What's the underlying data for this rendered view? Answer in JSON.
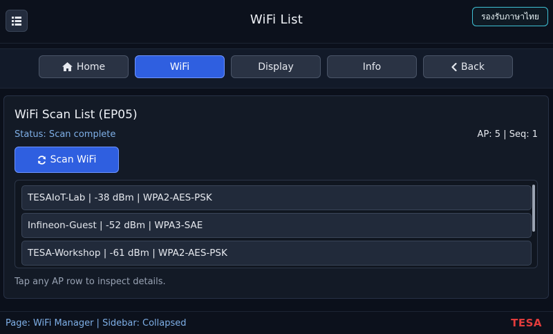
{
  "header": {
    "title": "WiFi List",
    "language_label": "รองรับภาษาไทย",
    "menu_icon": "list-icon"
  },
  "nav": {
    "tabs": [
      {
        "label": "Home",
        "icon": "home-icon"
      },
      {
        "label": "WiFi",
        "active": true
      },
      {
        "label": "Display"
      },
      {
        "label": "Info"
      },
      {
        "label": "Back",
        "icon": "chevron-left-icon"
      }
    ]
  },
  "main": {
    "title": "WiFi Scan List (EP05)",
    "status": "Status: Scan complete",
    "ap_info": "AP: 5 | Seq: 1",
    "scan_label": "Scan WiFi",
    "scan_icon": "refresh-icon",
    "networks": [
      "TESAIoT-Lab | -38 dBm | WPA2-AES-PSK",
      "Infineon-Guest | -52 dBm | WPA3-SAE",
      "TESA-Workshop | -61 dBm | WPA2-AES-PSK"
    ],
    "hint": "Tap any AP row to inspect details."
  },
  "footer": {
    "page_info": "Page: WiFi Manager | Sidebar: Collapsed",
    "logo": "TESA"
  },
  "colors": {
    "accent": "#2f5fe0",
    "lang_border": "#3fc2d6",
    "status_text": "#7fb0e8",
    "logo": "#e23c3c"
  }
}
